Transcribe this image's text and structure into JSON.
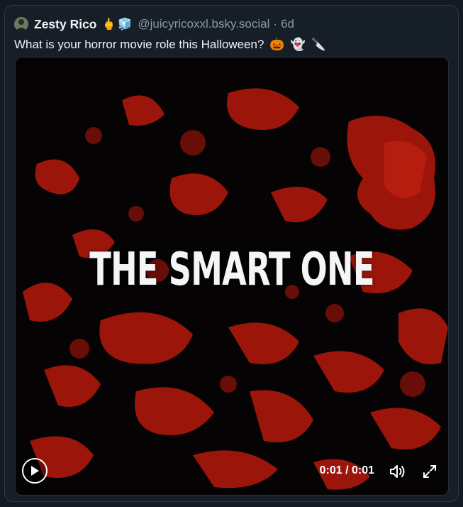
{
  "post": {
    "author": "Zesty Rico",
    "author_emojis": [
      "🖕",
      "🧊"
    ],
    "handle": "@juicyricoxxl.bsky.social",
    "separator": "·",
    "time": "6d",
    "text": "What is your horror movie role this Halloween?",
    "text_emojis": [
      "🎃",
      "👻",
      "🔪"
    ]
  },
  "video": {
    "title_text": "THE SMART ONE",
    "time_display": "0:01 / 0:01"
  },
  "colors": {
    "blood": "#b51c0e",
    "card_bg": "#161e27"
  },
  "icons": [
    "avatar",
    "middle-finger-emoji",
    "ice-cube-emoji",
    "jack-o-lantern-emoji",
    "ghost-emoji",
    "knife-emoji",
    "play-icon",
    "volume-icon",
    "fullscreen-icon"
  ]
}
